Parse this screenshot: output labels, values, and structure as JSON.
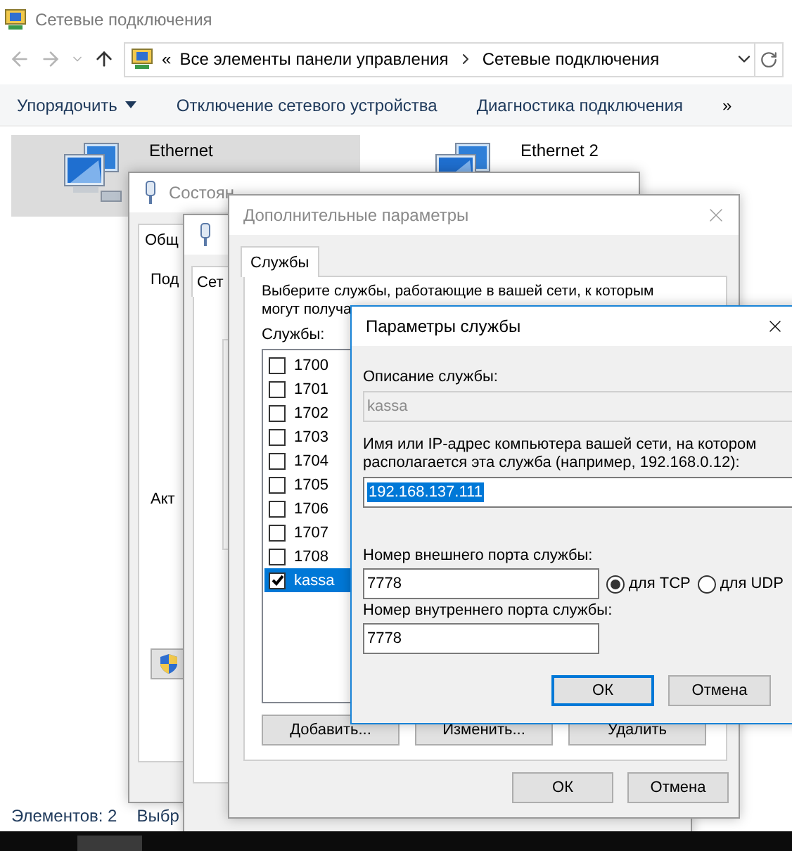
{
  "explorer": {
    "title": "Сетевые подключения",
    "address": {
      "prefix": "«",
      "segments": [
        "Все элементы панели управления",
        "Сетевые подключения"
      ]
    },
    "toolbar": [
      {
        "label": "Упорядочить",
        "kind": "menu"
      },
      {
        "label": "Отключение сетевого устройства",
        "kind": "command"
      },
      {
        "label": "Диагностика подключения",
        "kind": "command"
      },
      {
        "label": "»",
        "kind": "more"
      }
    ],
    "connections": [
      {
        "name": "Ethernet",
        "selected": true
      },
      {
        "name": "Ethernet 2",
        "selected": false
      }
    ],
    "status_bar": [
      "Элементов: 2",
      "Выбр"
    ]
  },
  "status_dialog": {
    "title": "Состоян",
    "tab": "Общ",
    "labels": [
      "Под",
      "Акт"
    ]
  },
  "properties_dialog": {
    "tab": "Сет"
  },
  "advanced_dialog": {
    "title": "Дополнительные параметры",
    "tabs": [
      {
        "label": "Службы",
        "selected": true
      }
    ],
    "intro": [
      "Выберите службы, работающие в вашей сети, к которым",
      "могут получа"
    ],
    "list_label": "Службы:",
    "services": [
      {
        "name": "1700",
        "checked": false,
        "selected": false
      },
      {
        "name": "1701",
        "checked": false,
        "selected": false
      },
      {
        "name": "1702",
        "checked": false,
        "selected": false
      },
      {
        "name": "1703",
        "checked": false,
        "selected": false
      },
      {
        "name": "1704",
        "checked": false,
        "selected": false
      },
      {
        "name": "1705",
        "checked": false,
        "selected": false
      },
      {
        "name": "1706",
        "checked": false,
        "selected": false
      },
      {
        "name": "1707",
        "checked": false,
        "selected": false
      },
      {
        "name": "1708",
        "checked": false,
        "selected": false
      },
      {
        "name": "kassa",
        "checked": true,
        "selected": true
      }
    ],
    "list_buttons": [
      "Добавить...",
      "Изменить...",
      "Удалить"
    ],
    "buttons": [
      "ОК",
      "Отмена"
    ]
  },
  "service_dialog": {
    "title": "Параметры службы",
    "description_label": "Описание службы:",
    "description": {
      "value": "kassa",
      "disabled": true
    },
    "host_label": "Имя или IP-адрес компьютера вашей сети, на котором располагается эта служба (например, 192.168.0.12):",
    "host": {
      "value": "192.168.137.111",
      "text_selected": true
    },
    "external_port_label": "Номер внешнего порта службы:",
    "external_port": "7778",
    "protocols": [
      {
        "label": "для TCP",
        "selected": true
      },
      {
        "label": "для UDP",
        "selected": false
      }
    ],
    "internal_port_label": "Номер внутреннего порта службы:",
    "internal_port": "7778",
    "buttons": [
      {
        "label": "ОК",
        "default": true
      },
      {
        "label": "Отмена",
        "default": false
      }
    ]
  }
}
